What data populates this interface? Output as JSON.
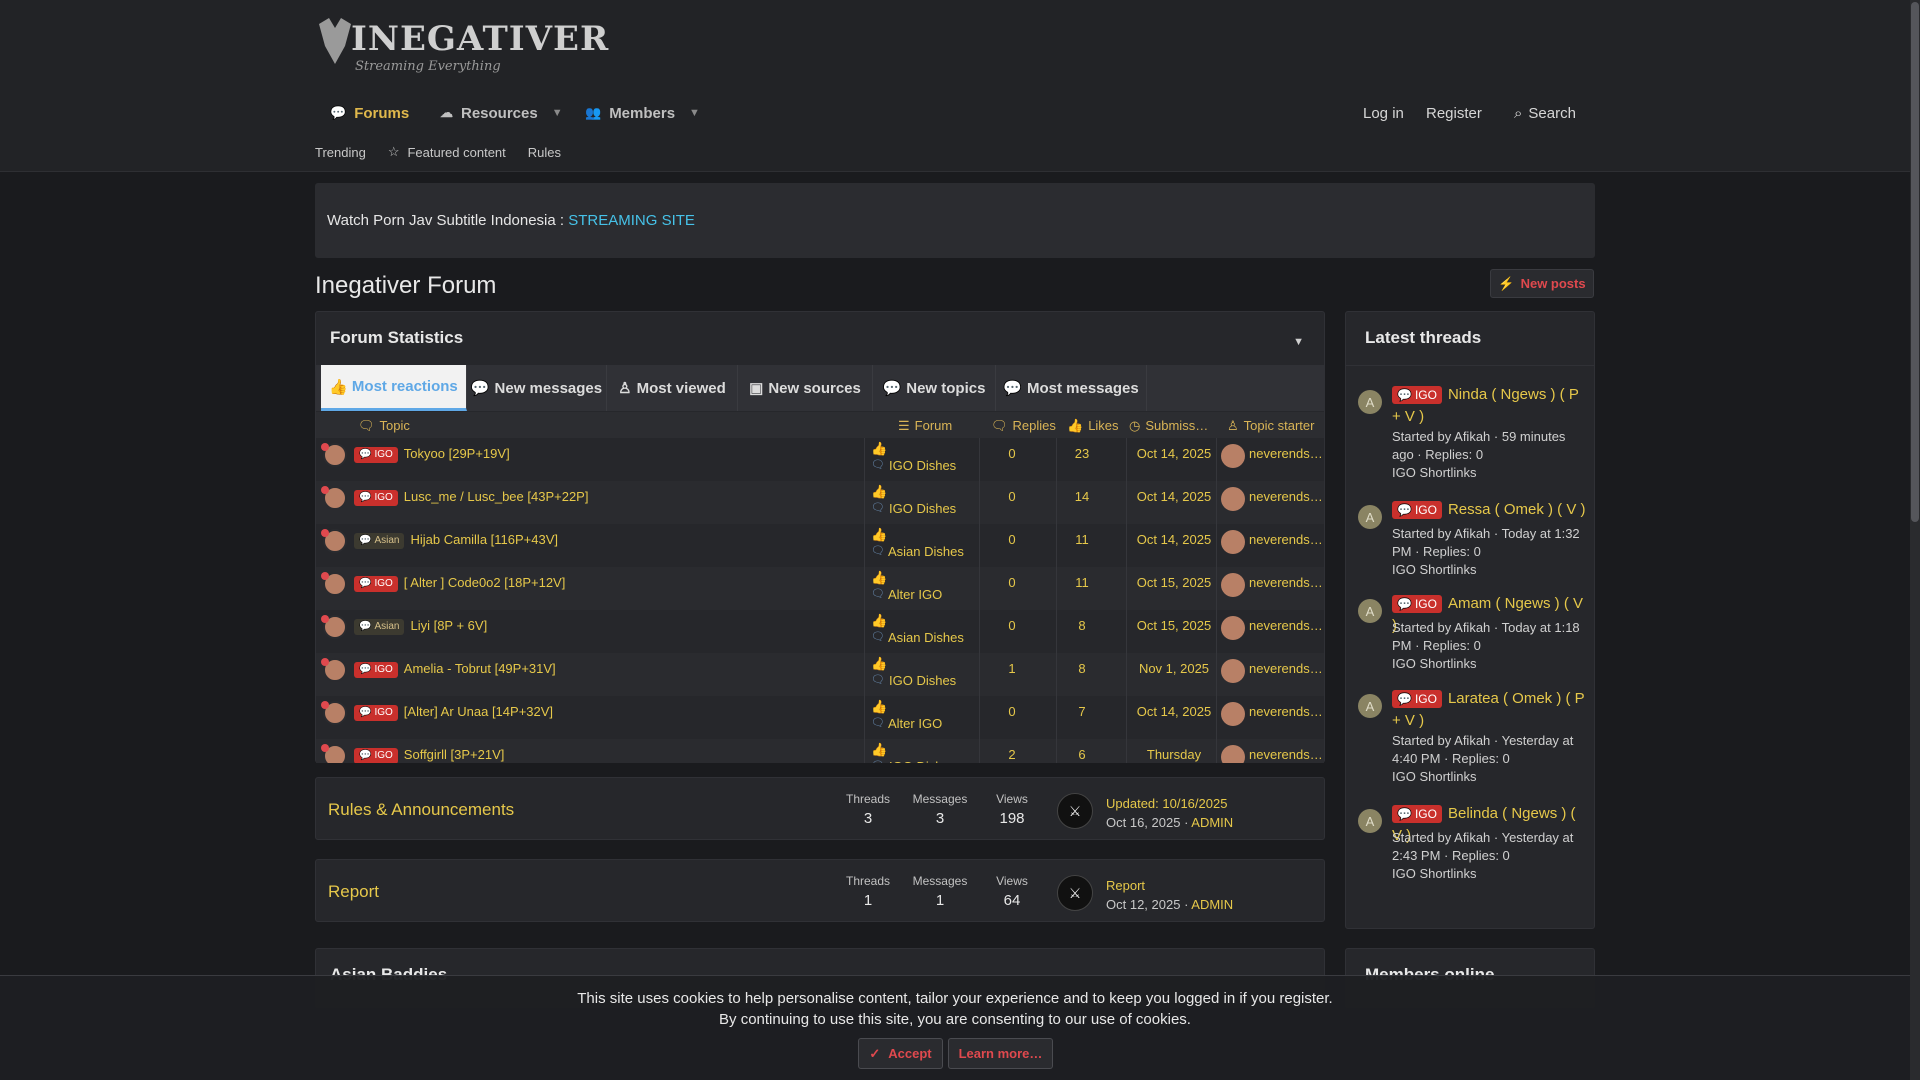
{
  "brand": {
    "logo_text": "INEGATIVER",
    "logo_sub": "Streaming Everything"
  },
  "nav": {
    "forums": "Forums",
    "resources": "Resources",
    "members": "Members",
    "login": "Log in",
    "register": "Register",
    "search": "Search"
  },
  "subnav": {
    "trending": "Trending",
    "featured": "Featured content",
    "rules": "Rules"
  },
  "notice": {
    "text": "Watch Porn Jav Subtitle Indonesia : ",
    "link": "STREAMING SITE"
  },
  "page_title": "Inegativer Forum",
  "new_posts": "New posts",
  "stats": {
    "title": "Forum Statistics",
    "tabs": [
      "Most reactions",
      "New messages",
      "Most viewed",
      "New sources",
      "New topics",
      "Most messages"
    ],
    "columns": {
      "topic": "Topic",
      "forum": "Forum",
      "replies": "Replies",
      "likes": "Likes",
      "submission": "Submiss…",
      "starter": "Topic starter"
    },
    "rows": [
      {
        "prefix": "IGO",
        "title": "Tokyoo [29P+19V]",
        "forum": "IGO Dishes",
        "replies": "0",
        "likes": "23",
        "date": "Oct 14, 2025",
        "starter": "neverends…"
      },
      {
        "prefix": "IGO",
        "title": "Lusc_me / Lusc_bee [43P+22P]",
        "forum": "IGO Dishes",
        "replies": "0",
        "likes": "14",
        "date": "Oct 14, 2025",
        "starter": "neverends…"
      },
      {
        "prefix": "Asian",
        "title": "Hijab Camilla [116P+43V]",
        "forum": "Asian Dishes",
        "replies": "0",
        "likes": "11",
        "date": "Oct 14, 2025",
        "starter": "neverends…"
      },
      {
        "prefix": "IGO",
        "title": "[ Alter ] Code0o2 [18P+12V]",
        "forum": "Alter IGO",
        "replies": "0",
        "likes": "11",
        "date": "Oct 15, 2025",
        "starter": "neverends…"
      },
      {
        "prefix": "Asian",
        "title": "Liyi [8P + 6V]",
        "forum": "Asian Dishes",
        "replies": "0",
        "likes": "8",
        "date": "Oct 15, 2025",
        "starter": "neverends…"
      },
      {
        "prefix": "IGO",
        "title": "Amelia - Tobrut [49P+31V]",
        "forum": "IGO Dishes",
        "replies": "1",
        "likes": "8",
        "date": "Nov 1, 2025",
        "starter": "neverends…"
      },
      {
        "prefix": "IGO",
        "title": "[Alter] Ar Unaa [14P+32V]",
        "forum": "Alter IGO",
        "replies": "0",
        "likes": "7",
        "date": "Oct 14, 2025",
        "starter": "neverends…"
      },
      {
        "prefix": "IGO",
        "title": "Soffgirll [3P+21V]",
        "forum": "IGO Dishes",
        "replies": "2",
        "likes": "6",
        "date": "Thursday at…",
        "starter": "neverends…"
      }
    ]
  },
  "nodes": [
    {
      "title": "Rules & Announcements",
      "threads_label": "Threads",
      "threads": "3",
      "messages_label": "Messages",
      "messages": "3",
      "views_label": "Views",
      "views": "198",
      "last_title": "Updated: 10/16/2025",
      "last_date": "Oct 16, 2025",
      "last_user": "ADMIN"
    },
    {
      "title": "Report",
      "threads_label": "Threads",
      "threads": "1",
      "messages_label": "Messages",
      "messages": "1",
      "views_label": "Views",
      "views": "64",
      "last_title": "Report",
      "last_date": "Oct 12, 2025",
      "last_user": "ADMIN"
    }
  ],
  "asian_block_title": "Asian Baddies",
  "latest": {
    "title": "Latest threads",
    "items": [
      {
        "avatar": "A",
        "prefix": "IGO",
        "title": "Ninda ( Ngews ) ( P + V )",
        "meta": "Started by Afikah · 59 minutes ago · Replies: 0",
        "forum": "IGO Shortlinks"
      },
      {
        "avatar": "A",
        "prefix": "IGO",
        "title": "Ressa ( Omek ) ( V )",
        "meta": "Started by Afikah · Today at 1:32 PM · Replies: 0",
        "forum": "IGO Shortlinks"
      },
      {
        "avatar": "A",
        "prefix": "IGO",
        "title": "Amam ( Ngews ) ( V )",
        "meta": "Started by Afikah · Today at 1:18 PM · Replies: 0",
        "forum": "IGO Shortlinks"
      },
      {
        "avatar": "A",
        "prefix": "IGO",
        "title": "Laratea ( Omek ) ( P + V )",
        "meta": "Started by Afikah · Yesterday at 4:40 PM · Replies: 0",
        "forum": "IGO Shortlinks"
      },
      {
        "avatar": "A",
        "prefix": "IGO",
        "title": "Belinda ( Ngews ) ( V )",
        "meta": "Started by Afikah · Yesterday at 2:43 PM · Replies: 0",
        "forum": "IGO Shortlinks"
      }
    ]
  },
  "members_online_title": "Members online",
  "cookie": {
    "line1": "This site uses cookies to help personalise content, tailor your experience and to keep you logged in if you register.",
    "line2": "By continuing to use this site, you are consenting to our use of cookies.",
    "accept": "Accept",
    "learn": "Learn more…"
  },
  "colors": {
    "accent": "#e6c84a",
    "link_blue": "#46c2e8",
    "igo_red": "#c9302c",
    "active_tab": "#5fa8e6"
  }
}
